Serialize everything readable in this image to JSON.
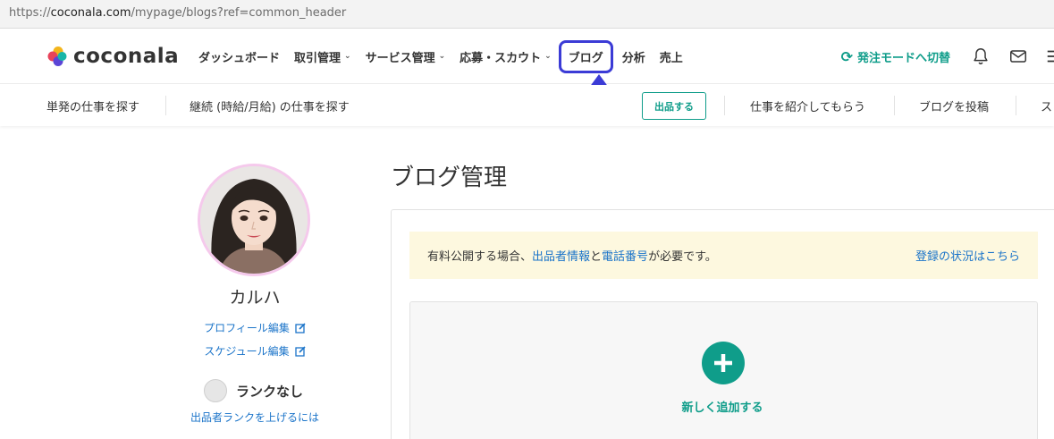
{
  "browser": {
    "url_prefix": "https://",
    "url_host": "coconala.com",
    "url_path": "/mypage/blogs?ref=common_header"
  },
  "header": {
    "logo_text": "coconala",
    "nav": [
      {
        "label": "ダッシュボード",
        "has_dropdown": false
      },
      {
        "label": "取引管理",
        "has_dropdown": true
      },
      {
        "label": "サービス管理",
        "has_dropdown": true
      },
      {
        "label": "応募・スカウト",
        "has_dropdown": true
      },
      {
        "label": "ブログ",
        "has_dropdown": false,
        "highlighted": true
      },
      {
        "label": "分析",
        "has_dropdown": false
      },
      {
        "label": "売上",
        "has_dropdown": false
      }
    ],
    "mode_switch_label": "発注モードへ切替",
    "icons": [
      "sync-icon",
      "bell-icon",
      "mail-icon",
      "menu-icon"
    ],
    "dropdown_glyph": "⌄"
  },
  "subnav": {
    "items": [
      "単発の仕事を探す",
      "継続 (時給/月給) の仕事を探す",
      "仕事を紹介してもらう",
      "ブログを投稿",
      "ス"
    ],
    "post_button": "出品する"
  },
  "profile": {
    "name": "カルハ",
    "profile_edit": "プロフィール編集",
    "schedule_edit": "スケジュール編集",
    "rank": "ランクなし",
    "rank_link": "出品者ランクを上げるには"
  },
  "main": {
    "title": "ブログ管理",
    "notice": {
      "text_1": "有料公開する場合、",
      "link_1": "出品者情報",
      "text_2": "と",
      "link_2": "電話番号",
      "text_3": "が必要です。",
      "right_link": "登録の状況はこちら"
    },
    "add_label": "新しく追加する"
  },
  "colors": {
    "brand_green": "#0f9d8a",
    "link_blue": "#1b74c9",
    "annotation_blue": "#3b3bd6",
    "notice_bg": "#fdf8df"
  }
}
